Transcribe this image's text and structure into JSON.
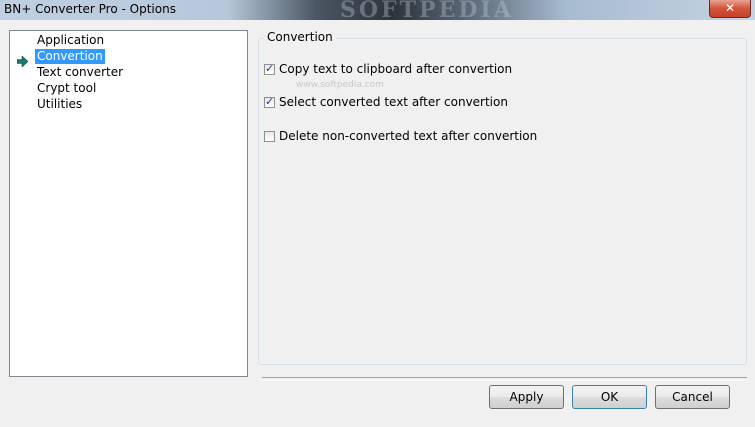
{
  "window": {
    "title": "BN+ Converter Pro - Options",
    "watermark": "SOFTPEDIA",
    "close_glyph": "✕"
  },
  "tree": {
    "items": [
      {
        "label": "Application",
        "selected": false
      },
      {
        "label": "Convertion",
        "selected": true
      },
      {
        "label": "Text converter",
        "selected": false
      },
      {
        "label": "Crypt tool",
        "selected": false
      },
      {
        "label": "Utilities",
        "selected": false
      }
    ]
  },
  "group": {
    "label": "Convertion",
    "options": [
      {
        "label": "Copy text to clipboard after convertion",
        "checked": true
      },
      {
        "label": "Select converted text after convertion",
        "checked": true
      },
      {
        "label": "Delete non-converted text after convertion",
        "checked": false
      }
    ],
    "watermark_small": "www.softpedia.com"
  },
  "buttons": {
    "apply": "Apply",
    "ok": "OK",
    "cancel": "Cancel"
  },
  "colors": {
    "selection": "#3399ff",
    "arrow": "#1e7a6a"
  }
}
